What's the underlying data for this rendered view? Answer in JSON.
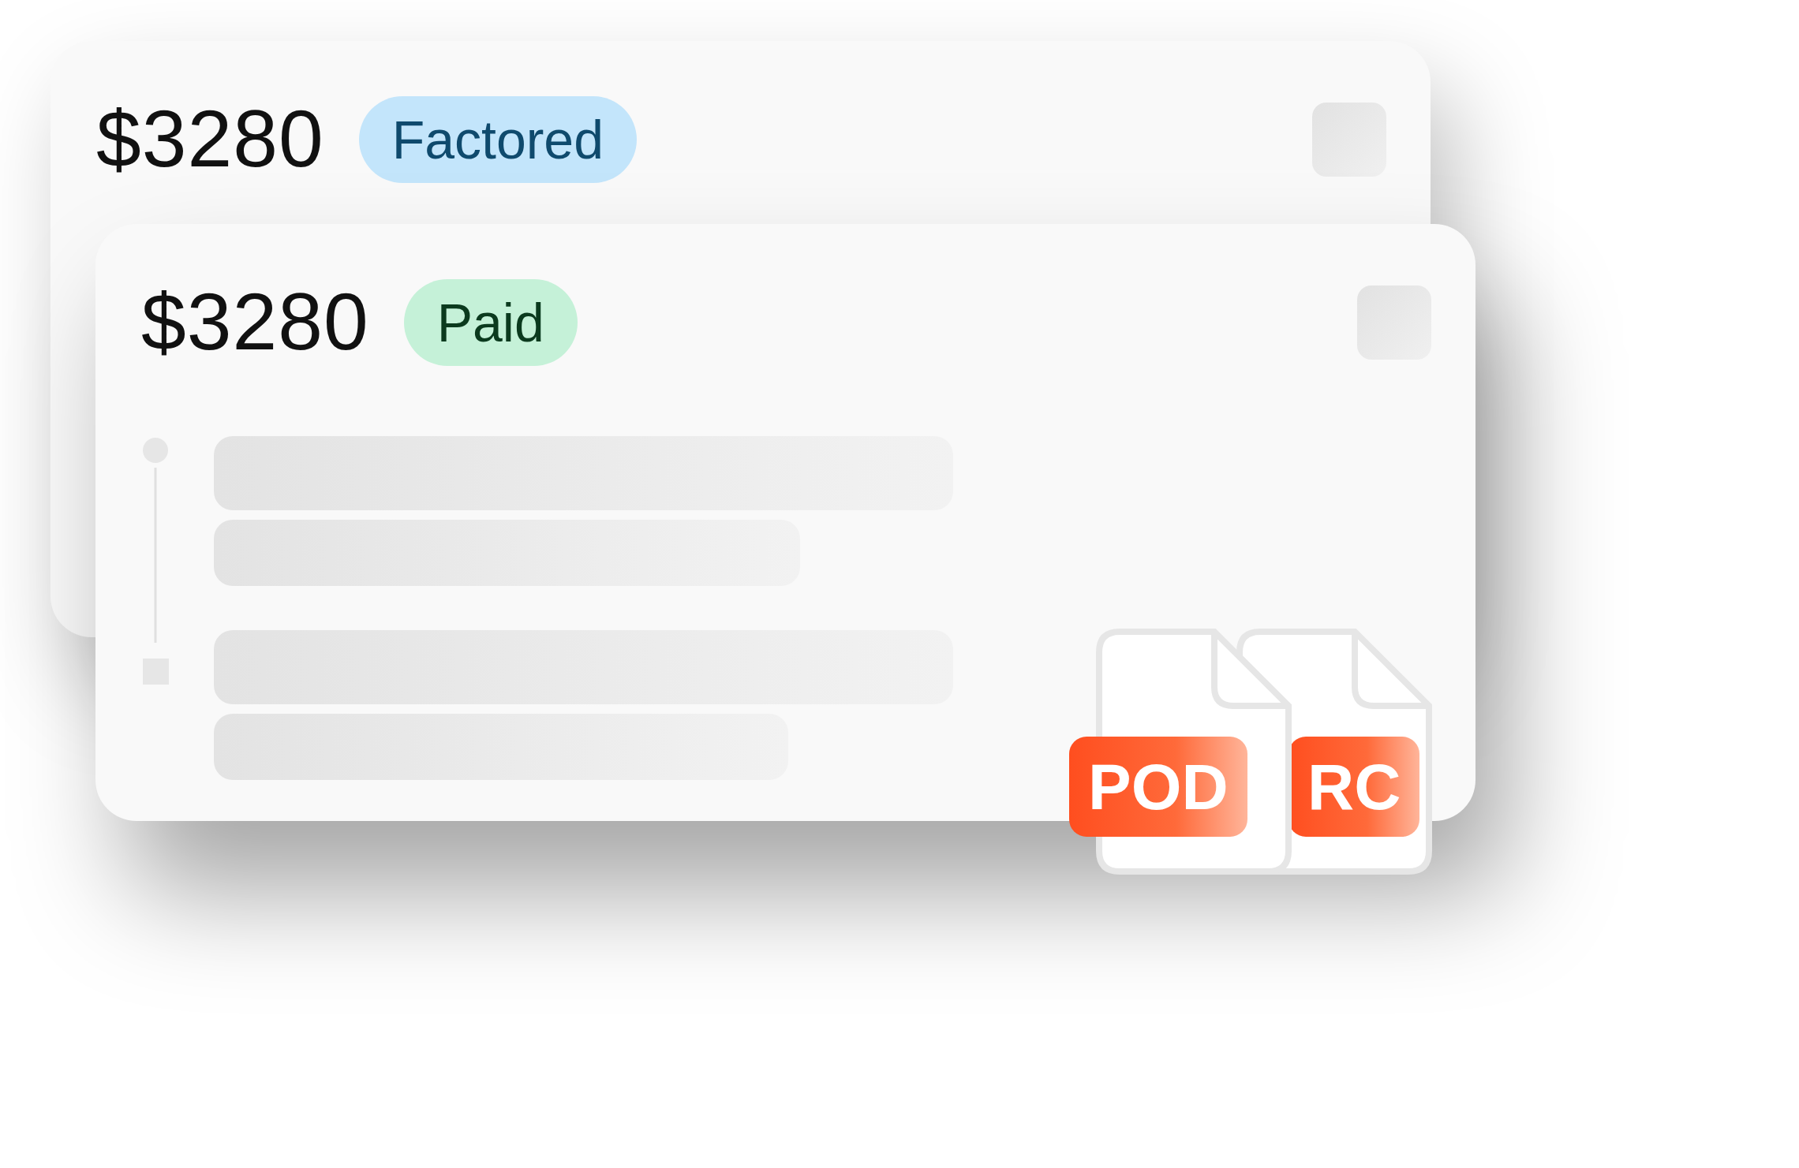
{
  "cards": [
    {
      "amount": "$3280",
      "status": {
        "label": "Factored",
        "kind": "factored"
      }
    },
    {
      "amount": "$3280",
      "status": {
        "label": "Paid",
        "kind": "paid"
      }
    }
  ],
  "documents": [
    {
      "label": "POD"
    },
    {
      "label": "RC"
    }
  ]
}
